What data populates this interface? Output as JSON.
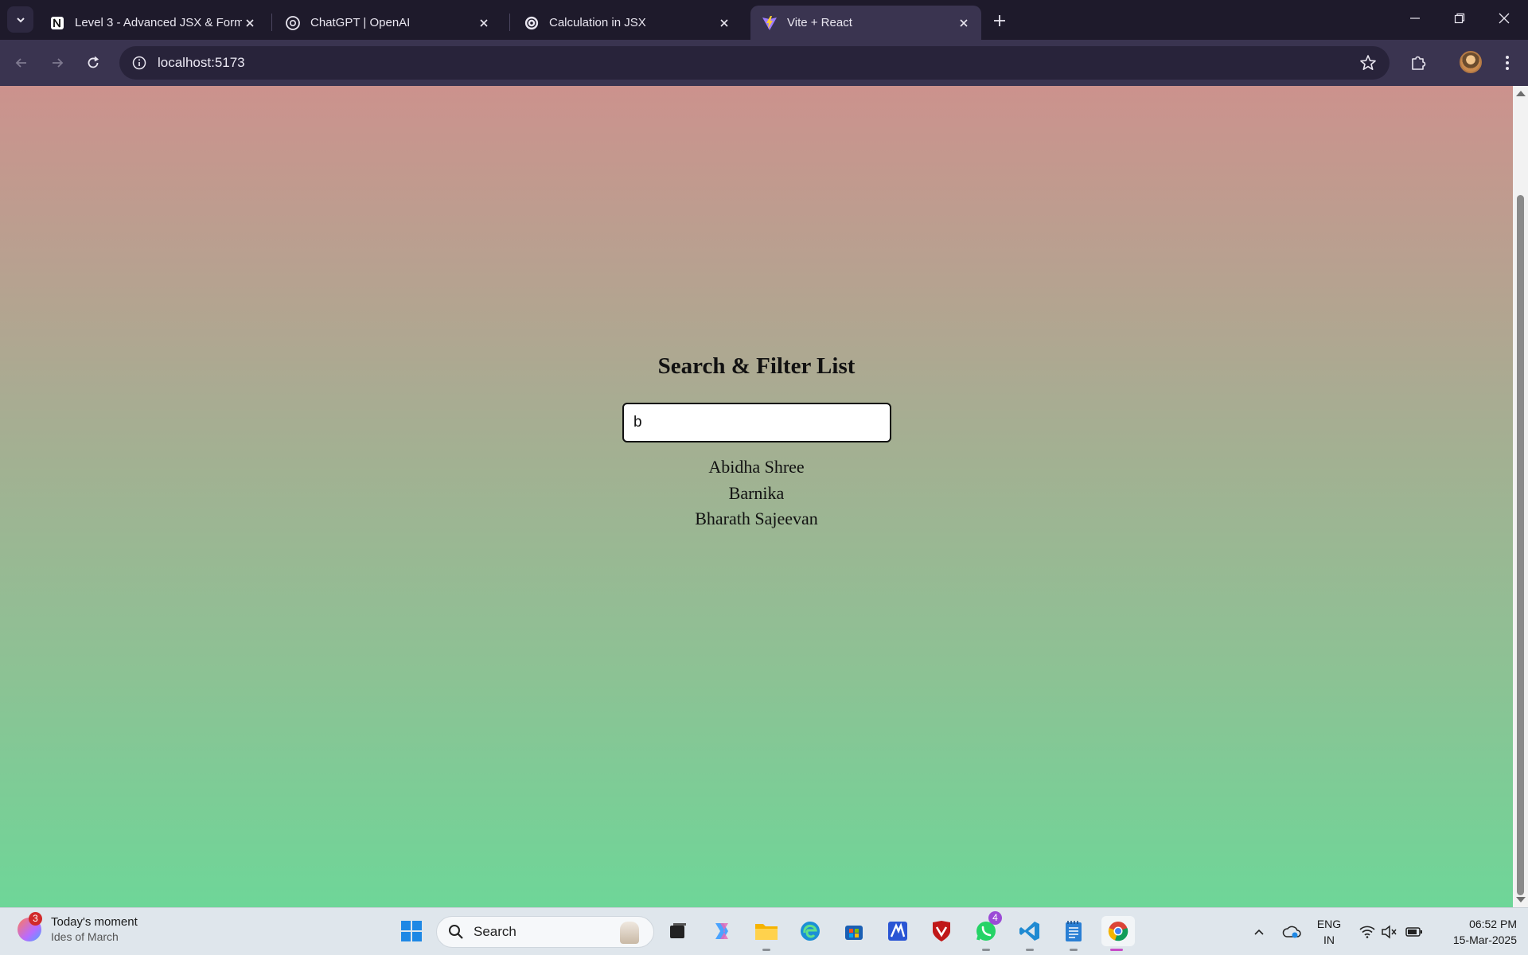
{
  "browser": {
    "tabs": [
      {
        "title": "Level 3 - Advanced JSX & Form",
        "favicon": "notion-icon"
      },
      {
        "title": "ChatGPT | OpenAI",
        "favicon": "openai-icon"
      },
      {
        "title": "Calculation in JSX",
        "favicon": "openai-icon"
      },
      {
        "title": "Vite + React",
        "favicon": "vite-icon",
        "active": true
      }
    ],
    "url": "localhost:5173"
  },
  "page": {
    "heading": "Search & Filter List",
    "search_value": "b",
    "results": [
      "Abidha Shree",
      "Barnika",
      "Bharath Sajeevan"
    ],
    "gradient": {
      "top": "#cc928d",
      "bottom": "#6ed698"
    }
  },
  "taskbar": {
    "widget": {
      "title": "Today's moment",
      "subtitle": "Ides of March",
      "badge": "3"
    },
    "search_label": "Search",
    "apps": [
      "windows-start-icon",
      "task-view-icon",
      "copilot-icon",
      "file-explorer-icon",
      "edge-icon",
      "store-icon",
      "mcafee-icon",
      "mcafee-shield-icon",
      "whatsapp-icon",
      "vscode-icon",
      "notepad-icon",
      "chrome-icon"
    ],
    "whatsapp_badge": "4",
    "language": {
      "line1": "ENG",
      "line2": "IN"
    },
    "clock": {
      "time": "06:52 PM",
      "date": "15-Mar-2025"
    }
  }
}
